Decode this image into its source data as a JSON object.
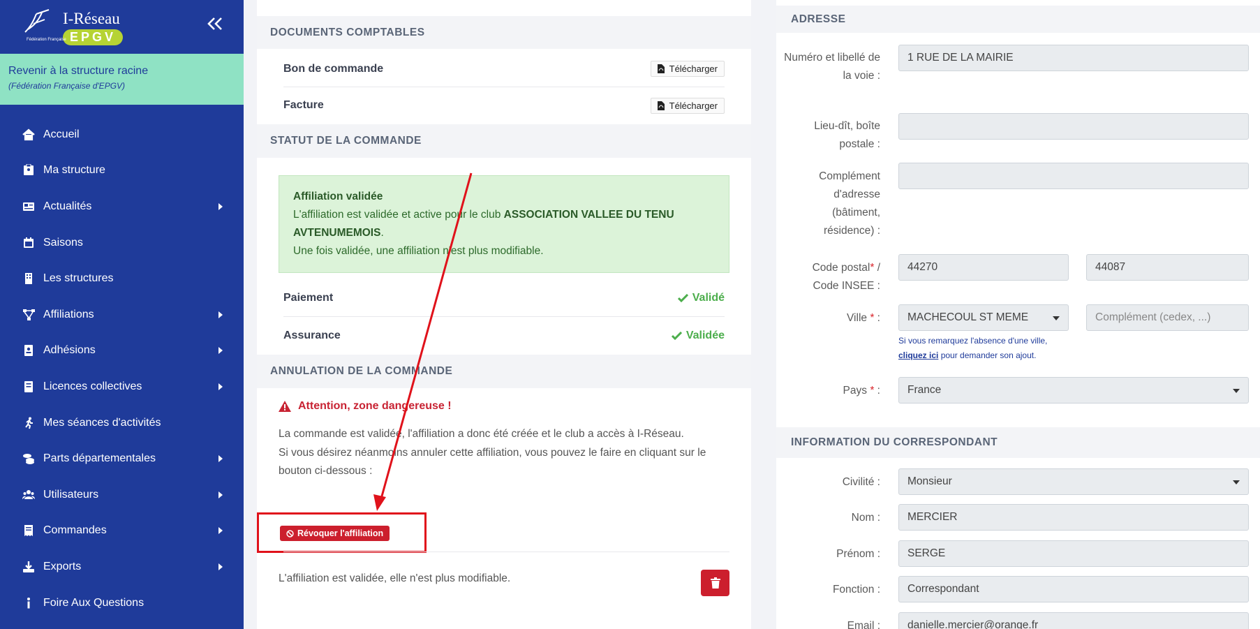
{
  "sidebar": {
    "logo_title": "I-Réseau",
    "logo_badge": "EPGV",
    "logo_sub": "Fédération Française",
    "root_link": "Revenir à la structure racine",
    "root_sub": "(Fédération Française d'EPGV)",
    "items": [
      {
        "label": "Accueil",
        "icon": "home-icon",
        "has_caret": false
      },
      {
        "label": "Ma structure",
        "icon": "id-badge-icon",
        "has_caret": false
      },
      {
        "label": "Actualités",
        "icon": "newspaper-icon",
        "has_caret": true
      },
      {
        "label": "Saisons",
        "icon": "calendar-icon",
        "has_caret": false
      },
      {
        "label": "Les structures",
        "icon": "building-icon",
        "has_caret": false
      },
      {
        "label": "Affiliations",
        "icon": "network-icon",
        "has_caret": true
      },
      {
        "label": "Adhésions",
        "icon": "id-card-icon",
        "has_caret": true
      },
      {
        "label": "Licences collectives",
        "icon": "license-icon",
        "has_caret": true
      },
      {
        "label": "Mes séances d'activités",
        "icon": "running-icon",
        "has_caret": false
      },
      {
        "label": "Parts départementales",
        "icon": "coins-icon",
        "has_caret": true
      },
      {
        "label": "Utilisateurs",
        "icon": "users-icon",
        "has_caret": true
      },
      {
        "label": "Commandes",
        "icon": "receipt-icon",
        "has_caret": true
      },
      {
        "label": "Exports",
        "icon": "download-icon",
        "has_caret": true
      },
      {
        "label": "Foire Aux Questions",
        "icon": "info-icon",
        "has_caret": false
      }
    ]
  },
  "documents": {
    "title": "DOCUMENTS COMPTABLES",
    "rows": [
      {
        "label": "Bon de commande",
        "button": "Télécharger"
      },
      {
        "label": "Facture",
        "button": "Télécharger"
      }
    ]
  },
  "statut": {
    "title": "STATUT DE LA COMMANDE",
    "alert_title": "Affiliation validée",
    "alert_line1_pre": "L'affiliation est validée et active pour le club ",
    "alert_club": "ASSOCIATION VALLEE DU TENU AVTENUMEMOIS",
    "alert_line1_post": ".",
    "alert_line2": "Une fois validée, une affiliation n'est plus modifiable.",
    "rows": [
      {
        "label": "Paiement",
        "value": "Validé"
      },
      {
        "label": "Assurance",
        "value": "Validée"
      }
    ]
  },
  "annulation": {
    "title": "ANNULATION DE LA COMMANDE",
    "warning": "Attention, zone dangereuse !",
    "text1": "La commande est validée, l'affiliation a donc été créée et le club a accès à I-Réseau.",
    "text2": "Si vous désirez néanmoins annuler cette affiliation, vous pouvez le faire en cliquant sur le bouton ci-dessous :",
    "revoke_button": "Révoquer l'affiliation",
    "footer_note": "L'affiliation est validée, elle n'est plus modifiable."
  },
  "adresse": {
    "title": "ADRESSE",
    "voie_label": "Numéro et libellé de la voie :",
    "voie_value": "1 RUE DE LA MAIRIE",
    "lieudit_label": "Lieu-dît, boîte postale :",
    "lieudit_value": "",
    "complement_label": "Complément d'adresse (bâtiment, résidence) :",
    "complement_value": "",
    "cp_label_a": "Code postal",
    "cp_label_b": "/",
    "cp_label_c": "Code INSEE :",
    "cp_value": "44270",
    "insee_value": "44087",
    "ville_label": "Ville",
    "ville_value": "MACHECOUL ST MEME",
    "ville_complement_placeholder": "Complément (cedex, ...)",
    "hint_pre": "Si vous remarquez l'absence d'une ville,",
    "hint_link": "cliquez ici",
    "hint_post": " pour demander son ajout.",
    "pays_label": "Pays",
    "pays_value": "France",
    "required_mark": "*",
    "colon": " :"
  },
  "correspondant": {
    "title": "INFORMATION DU CORRESPONDANT",
    "civilite_label": "Civilité :",
    "civilite_value": "Monsieur",
    "nom_label": "Nom :",
    "nom_value": "MERCIER",
    "prenom_label": "Prénom :",
    "prenom_value": "SERGE",
    "fonction_label": "Fonction :",
    "fonction_value": "Correspondant",
    "email_label": "Email :",
    "email_value": "danielle.mercier@orange.fr"
  },
  "colors": {
    "sidebar_bg": "#1f3b9a",
    "root_banner": "#8fe2c4",
    "success": "#4cae4c",
    "danger": "#cc1f2d",
    "annotation": "#e0121b"
  }
}
